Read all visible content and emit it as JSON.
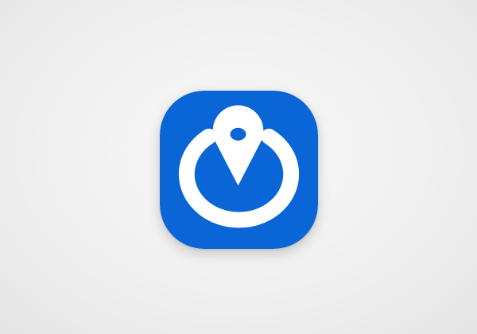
{
  "background_color": "#f2f2f2",
  "app_icon": {
    "name": "location-ring-app-icon",
    "accent_color": "#0a66d6",
    "glyph_color": "#ffffff",
    "symbols": [
      "map-pin-icon",
      "power-ring-icon"
    ]
  }
}
